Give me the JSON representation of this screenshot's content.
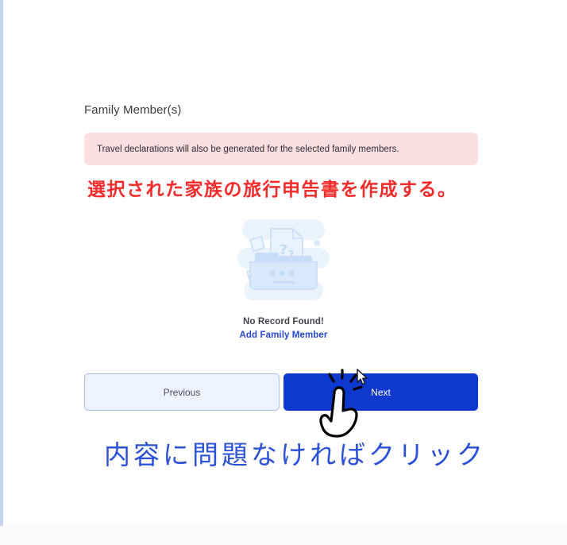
{
  "page": {
    "section_title": "Family Member(s)",
    "background_color": "#ffffff",
    "left_rail_color": "#c3d3ea"
  },
  "alert": {
    "text": "Travel declarations will also be generated for the selected family members.",
    "background_color": "#fadee1",
    "text_color": "#2e2e36"
  },
  "annotations": {
    "red_note": "選択された家族の旅行申告書を作成する。",
    "red_note_color": "#f32b2b",
    "blue_note": "内容に問題なければクリック",
    "blue_note_color": "#2b51d8"
  },
  "empty_state": {
    "illustration_name": "no-records-folder-illustration",
    "illustration_label": "??",
    "title": "No Record Found!",
    "link_label": "Add Family Member",
    "link_color": "#2948d8",
    "illustration_color": "#d9e8fa"
  },
  "buttons": {
    "previous_label": "Previous",
    "previous_bg": "#eef2fc",
    "previous_text_color": "#4a4f68",
    "next_label": "Next",
    "next_bg": "#0f38cf",
    "next_text_color": "#ffffff"
  },
  "cursor": {
    "pointer_icon": "hand-pointing-icon",
    "arrow_icon": "mouse-arrow-cursor-icon"
  }
}
